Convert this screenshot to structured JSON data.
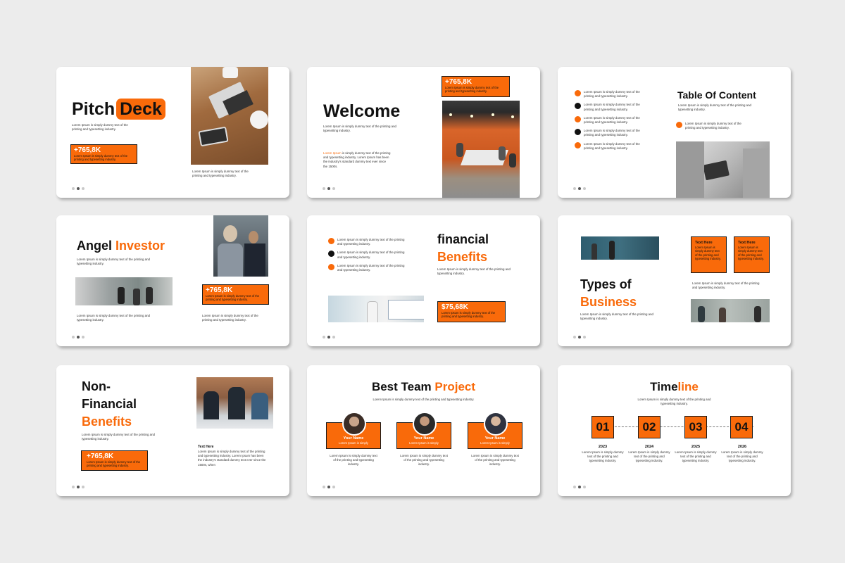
{
  "colors": {
    "accent": "#f96a0a",
    "background": "#ececec"
  },
  "lorem_short": "Lorem Ipsum is simply dummy text of the printing and typesetting industry.",
  "lorem_long": "is simply dummy text of the printing and typesetting industry. Lorem Ipsum has been the industry's standard dummy text ever since the 1500s.",
  "lorem_long_b": "Lorem Ipsum is simply dummy text of the printing and typesetting industry. Lorem Ipsum has been the industry's standard dummy text ever since the 1500s, when",
  "lorem_lead": "Lorem Ipsum",
  "stat_value": "+765,8K",
  "slide1": {
    "title_a": "Pitch",
    "title_b": "Deck"
  },
  "slide2": {
    "title": "Welcome"
  },
  "slide3": {
    "title": "Table Of Content"
  },
  "slide4": {
    "title_a": "Angel",
    "title_b": "Investor"
  },
  "slide5": {
    "title_a": "financial",
    "title_b": "Benefits",
    "stat": "$75,68K"
  },
  "slide6": {
    "title_a": "Types of",
    "title_b": "Business",
    "box_label": "Text Here"
  },
  "slide7": {
    "title_a": "Non-",
    "title_b": "Financial",
    "title_c": "Benefits",
    "text_here": "Text Here"
  },
  "slide8": {
    "title_a": "Best Team",
    "title_b": "Project",
    "members": [
      {
        "name": "Your Name",
        "role": "Lorem Ipsum is simply"
      },
      {
        "name": "Your Name",
        "role": "Lorem Ipsum is simply"
      },
      {
        "name": "Your Name",
        "role": "Lorem Ipsum is simply"
      }
    ]
  },
  "slide9": {
    "title_a": "Time",
    "title_b": "line",
    "steps": [
      {
        "num": "01",
        "year": "2023"
      },
      {
        "num": "02",
        "year": "2024"
      },
      {
        "num": "03",
        "year": "2025"
      },
      {
        "num": "04",
        "year": "2026"
      }
    ]
  },
  "icons": [
    "slide-nav-dots-icon"
  ]
}
